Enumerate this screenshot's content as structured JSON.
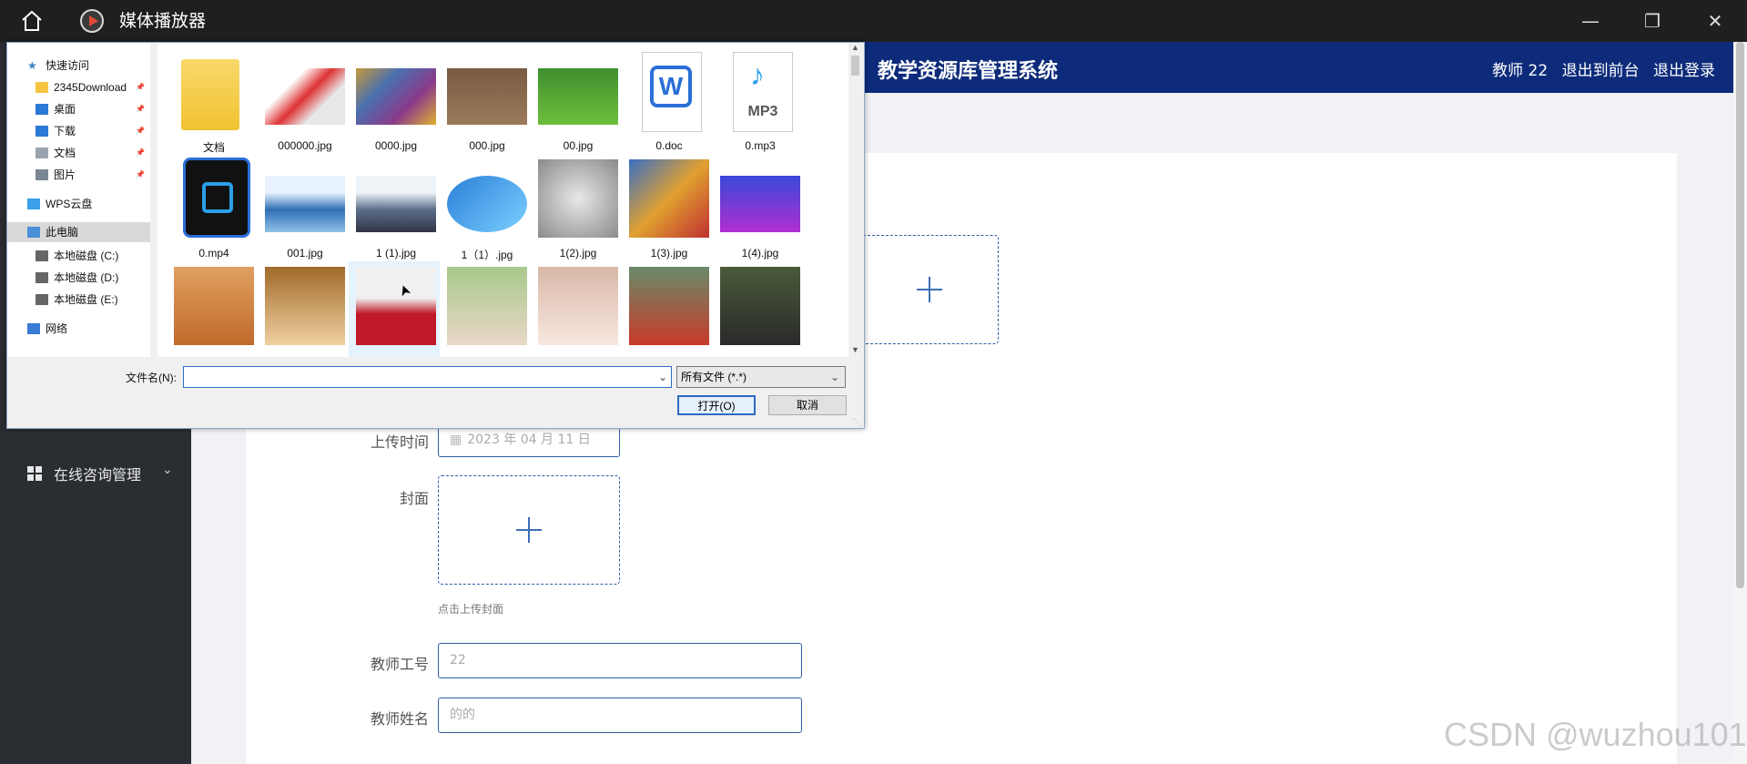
{
  "app": {
    "title": "媒体播放器",
    "home_icon": "home-icon",
    "logo_icon": "media-player-logo-icon",
    "minimize_icon": "minimize-icon",
    "restore_icon": "restore-icon",
    "close_icon": "close-icon"
  },
  "web": {
    "system_title": "教学资源库管理系统",
    "user": "教师 22",
    "back_to_front": "退出到前台",
    "logout": "退出登录",
    "sidebar_menu": "在线咨询管理",
    "form": {
      "upload_time_label": "上传时间",
      "upload_time_placeholder": "2023 年 04 月 11 日",
      "cover_label": "封面",
      "cover_hint": "点击上传封面",
      "teacher_id_label": "教师工号",
      "teacher_id_value": "22",
      "teacher_name_label": "教师姓名",
      "teacher_name_value": "的的"
    }
  },
  "dialog": {
    "nav": [
      {
        "label": "快速访问",
        "icon": "star-icon",
        "pinned": false
      },
      {
        "label": "2345Download",
        "icon": "folder-icon",
        "pinned": true
      },
      {
        "label": "桌面",
        "icon": "desktop-icon",
        "pinned": true
      },
      {
        "label": "下载",
        "icon": "download-icon",
        "pinned": true
      },
      {
        "label": "文档",
        "icon": "document-icon",
        "pinned": true
      },
      {
        "label": "图片",
        "icon": "pictures-icon",
        "pinned": true
      },
      {
        "label": "WPS云盘",
        "icon": "cloud-icon",
        "pinned": false
      },
      {
        "label": "此电脑",
        "icon": "computer-icon",
        "pinned": false
      },
      {
        "label": "本地磁盘 (C:)",
        "icon": "drive-icon",
        "pinned": false
      },
      {
        "label": "本地磁盘 (D:)",
        "icon": "drive-icon",
        "pinned": false
      },
      {
        "label": "本地磁盘 (E:)",
        "icon": "drive-icon",
        "pinned": false
      },
      {
        "label": "网络",
        "icon": "network-icon",
        "pinned": false
      }
    ],
    "files": [
      {
        "name": "文档",
        "kind": "folder"
      },
      {
        "name": "000000.jpg",
        "kind": "image"
      },
      {
        "name": "0000.jpg",
        "kind": "image"
      },
      {
        "name": "000.jpg",
        "kind": "image"
      },
      {
        "name": "00.jpg",
        "kind": "image"
      },
      {
        "name": "0.doc",
        "kind": "doc"
      },
      {
        "name": "0.mp3",
        "kind": "mp3"
      },
      {
        "name": "0.mp4",
        "kind": "mp4"
      },
      {
        "name": "001.jpg",
        "kind": "image"
      },
      {
        "name": "1 (1).jpg",
        "kind": "image"
      },
      {
        "name": "1（1）.jpg",
        "kind": "image"
      },
      {
        "name": "1(2).jpg",
        "kind": "image"
      },
      {
        "name": "1(3).jpg",
        "kind": "image"
      },
      {
        "name": "1(4).jpg",
        "kind": "image"
      },
      {
        "name": "",
        "kind": "image"
      },
      {
        "name": "",
        "kind": "image"
      },
      {
        "name": "",
        "kind": "image"
      },
      {
        "name": "",
        "kind": "image"
      },
      {
        "name": "",
        "kind": "image"
      },
      {
        "name": "",
        "kind": "image"
      },
      {
        "name": "",
        "kind": "image"
      }
    ],
    "doc_badge": "W",
    "mp3_badge": "MP3",
    "filename_label": "文件名(N):",
    "filename_value": "",
    "filetype_value": "所有文件 (*.*)",
    "open_button": "打开(O)",
    "cancel_button": "取消"
  },
  "watermark": "CSDN @wuzhou101",
  "colors": {
    "header": "#0d2b7a",
    "sidebar": "#2a2d31",
    "accent": "#2e5ea8",
    "selected": "#cce8ff",
    "folder": "#f5c542"
  }
}
